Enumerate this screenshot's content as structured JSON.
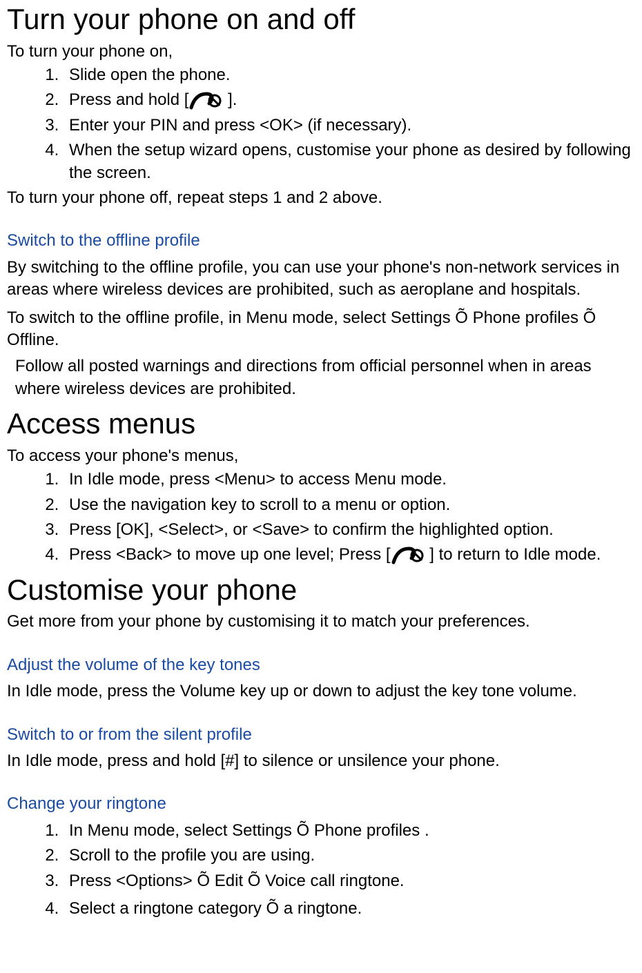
{
  "section1": {
    "heading": "Turn your phone on and off",
    "intro": "To turn your phone on,",
    "steps": {
      "s1": "Slide open the phone.",
      "s2a": "Press and hold [",
      "s2b": " ].",
      "s3": "Enter your PIN and press <OK> (if necessary).",
      "s4": "When the setup wizard opens, customise your phone as desired by following the screen."
    },
    "outro": "To turn your phone off, repeat steps 1 and 2 above.",
    "sub1": {
      "heading": "Switch to the offline profile",
      "p1": "By switching to the offline profile, you can use your phone's non-network services in areas where wireless devices are prohibited, such as aeroplane and hospitals.",
      "p2": "To switch to the offline profile, in Menu mode, select Settings Õ Phone profiles Õ Offline.",
      "note": "Follow all posted warnings and directions from official personnel when in areas where wireless devices are prohibited."
    }
  },
  "section2": {
    "heading": "Access menus",
    "intro": "To access your phone's menus,",
    "steps": {
      "s1": "In Idle mode, press <Menu> to access Menu mode.",
      "s2": "Use the navigation key to scroll to a menu or option.",
      "s3": "Press [OK], <Select>, or <Save> to confirm the highlighted option.",
      "s4a": "Press <Back> to move up one level; Press [",
      "s4b": " ] to return to Idle mode."
    }
  },
  "section3": {
    "heading": "Customise your phone",
    "intro": "Get more from your phone by customising it to match your preferences.",
    "sub1": {
      "heading": "Adjust the volume of the key tones",
      "p1": "In Idle mode, press the Volume key up or down to adjust the key tone volume."
    },
    "sub2": {
      "heading": "Switch to or from the silent profile",
      "p1": "In Idle mode, press and hold [#] to silence or unsilence your phone."
    },
    "sub3": {
      "heading": "Change your ringtone",
      "steps": {
        "s1": "In Menu mode, select Settings Õ Phone profiles .",
        "s2": "Scroll to the profile you are using.",
        "s3": "Press <Options> Õ Edit Õ Voice call ringtone.",
        "s4": "Select a ringtone category Õ a ringtone."
      }
    }
  }
}
